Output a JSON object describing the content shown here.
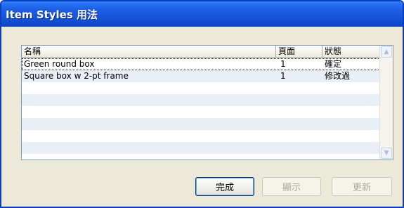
{
  "window": {
    "title": "Item Styles 用法"
  },
  "table": {
    "columns": [
      "名稱",
      "頁面",
      "狀態"
    ],
    "rows": [
      {
        "name": "Green round box",
        "page": "1",
        "status": "確定"
      },
      {
        "name": "Square box w 2-pt frame",
        "page": "1",
        "status": "修改過"
      }
    ]
  },
  "scrollbar": {
    "up_icon": "▲",
    "down_icon": "▼"
  },
  "buttons": {
    "done": "完成",
    "show": "顯示",
    "update": "更新"
  }
}
